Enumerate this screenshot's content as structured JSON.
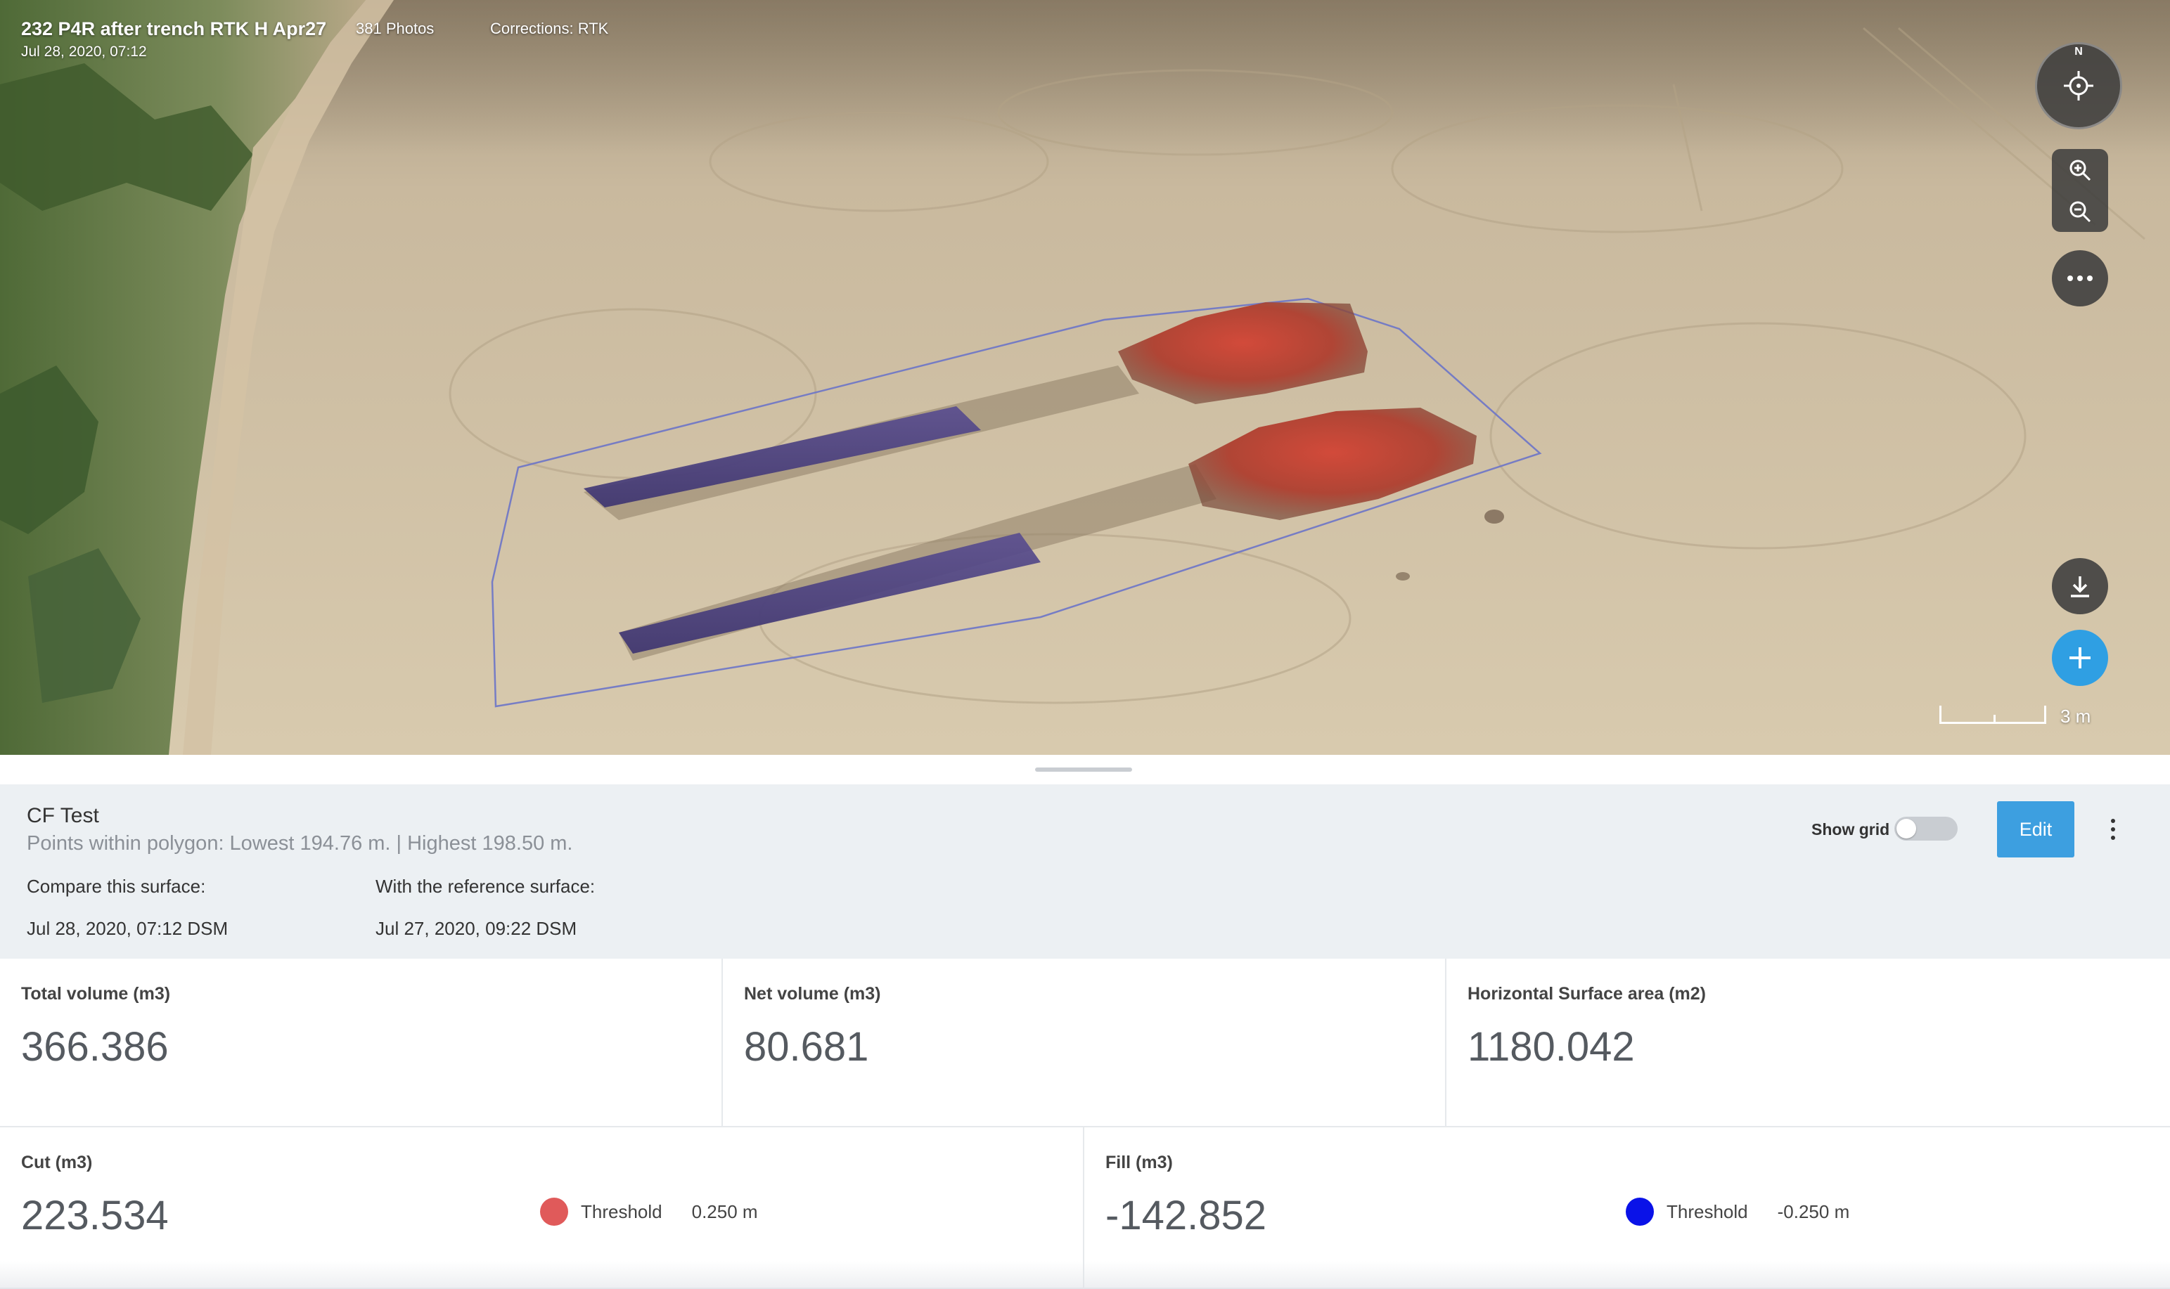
{
  "flight": {
    "title": "232 P4R after trench RTK H Apr27",
    "date": "Jul 28, 2020, 07:12",
    "photos": "381 Photos",
    "corrections": "Corrections: RTK"
  },
  "map_controls": {
    "compass_north": "N",
    "scale_label": "3 m",
    "icons": [
      "locate-icon",
      "zoom-in-icon",
      "zoom-out-icon",
      "more-horizontal-icon",
      "download-icon",
      "plus-icon"
    ]
  },
  "measurement": {
    "name": "CF Test",
    "summary": "Points within polygon: Lowest 194.76 m. | Highest 198.50 m.",
    "compare_label": "Compare this surface:",
    "compare_value": "Jul 28, 2020, 07:12 DSM",
    "reference_label": "With the reference surface:",
    "reference_value": "Jul 27, 2020, 09:22 DSM",
    "show_grid_label": "Show grid",
    "show_grid_on": false,
    "edit_label": "Edit"
  },
  "stats": {
    "total": {
      "label": "Total volume (m3)",
      "value": "366.386"
    },
    "net": {
      "label": "Net volume (m3)",
      "value": "80.681"
    },
    "area": {
      "label": "Horizontal Surface area (m2)",
      "value": "1180.042"
    },
    "cut": {
      "label": "Cut (m3)",
      "value": "223.534",
      "threshold_label": "Threshold",
      "threshold_value": "0.250 m",
      "color": "#e05a5a"
    },
    "fill": {
      "label": "Fill (m3)",
      "value": "-142.852",
      "threshold_label": "Threshold",
      "threshold_value": "-0.250 m",
      "color": "#0a12e8"
    }
  },
  "colors": {
    "accent": "#3d9fe0",
    "add_button": "#2f9fe3",
    "panel_bg": "#ecf0f3"
  }
}
